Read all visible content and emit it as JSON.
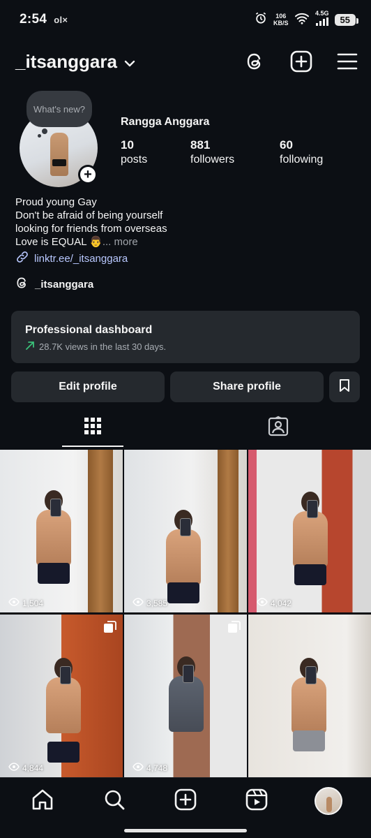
{
  "status_bar": {
    "time": "2:54",
    "extra": "ol×",
    "net_speed_value": "106",
    "net_speed_unit": "KB/S",
    "network": "4.5G",
    "battery": "55"
  },
  "header": {
    "username": "_itsanggara"
  },
  "profile": {
    "note_bubble": "What's new?",
    "full_name": "Rangga Anggara",
    "stats": [
      {
        "value": "10",
        "label": "posts"
      },
      {
        "value": "881",
        "label": "followers"
      },
      {
        "value": "60",
        "label": "following"
      }
    ],
    "bio_lines": [
      "Proud young Gay",
      "Don't be afraid of being yourself",
      "looking for friends from overseas",
      "Love is EQUAL 👨"
    ],
    "bio_more": "... more",
    "link": "linktr.ee/_itsanggara",
    "threads_handle": "_itsanggara"
  },
  "dashboard": {
    "title": "Professional dashboard",
    "subtitle": "28.7K views in the last 30 days."
  },
  "buttons": {
    "edit_profile": "Edit profile",
    "share_profile": "Share profile"
  },
  "posts": [
    {
      "views": "1,504"
    },
    {
      "views": "3,585"
    },
    {
      "views": "4,042"
    },
    {
      "views": "4,844"
    },
    {
      "views": "4,748"
    },
    {
      "views": ""
    }
  ],
  "colors": {
    "background": "#0c0f14",
    "card": "#25292e",
    "link": "#b9c8ff",
    "trend": "#3ac27a"
  }
}
